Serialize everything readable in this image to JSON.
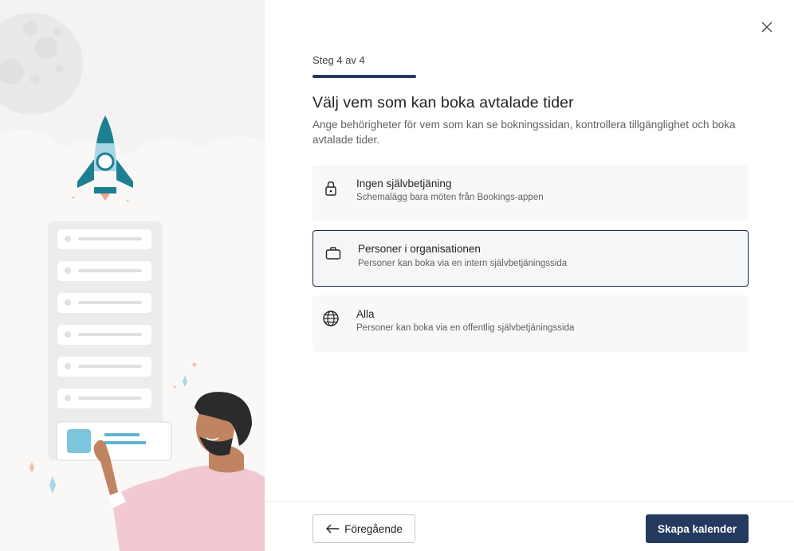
{
  "wizard": {
    "step_label": "Steg 4 av 4",
    "title": "Välj vem som kan boka avtalade tider",
    "subtitle": "Ange behörigheter för vem som kan se bokningssidan, kontrollera tillgänglighet och boka avtalade tider."
  },
  "options": [
    {
      "icon": "lock-icon",
      "title": "Ingen självbetjäning",
      "description": "Schemalägg bara möten från Bookings-appen",
      "selected": false
    },
    {
      "icon": "briefcase-icon",
      "title": "Personer i organisationen",
      "description": "Personer kan boka via en intern självbetjäningssida",
      "selected": true
    },
    {
      "icon": "globe-icon",
      "title": "Alla",
      "description": "Personer kan boka via en offentlig självbetjäningssida",
      "selected": false
    }
  ],
  "footer": {
    "back_label": "Föregående",
    "create_label": "Skapa kalender"
  },
  "colors": {
    "accent": "#243a5e",
    "rocket": "#1e7f92",
    "shirt": "#f2c9d3"
  }
}
